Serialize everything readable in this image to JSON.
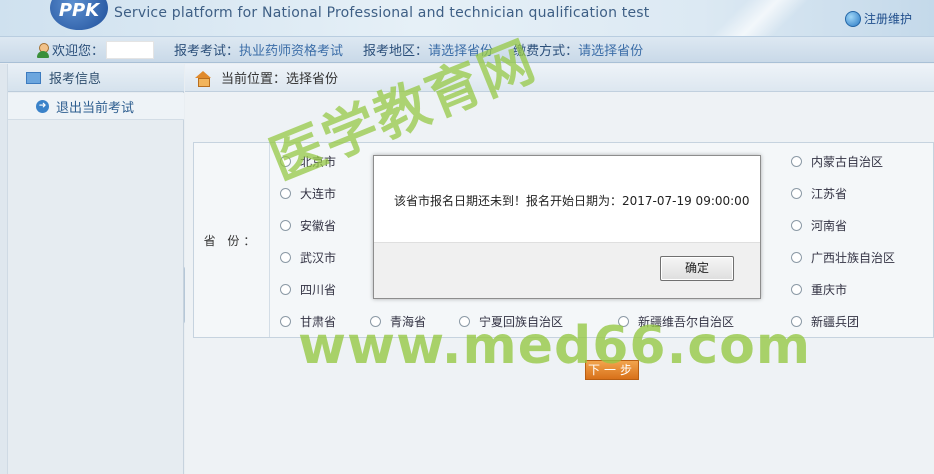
{
  "header": {
    "logo_text": "PPK",
    "subtitle": "Service platform for National Professional and technician qualification test",
    "register_link": "注册维护"
  },
  "infobar": {
    "welcome_label": "欢迎您：",
    "exam_label": "报考考试：",
    "exam_value": "执业药师资格考试",
    "region_label": "报考地区：",
    "region_value": "请选择省份",
    "payment_label": "缴费方式：",
    "payment_value": "请选择省份"
  },
  "sidebar": {
    "header": "报考信息",
    "items": [
      {
        "label": "退出当前考试"
      }
    ]
  },
  "main": {
    "breadcrumb": "当前位置：选择省份",
    "province_label": "省 份：",
    "provinces": [
      "北京市",
      "内蒙古自治区",
      "大连市",
      "江苏省",
      "安徽省",
      "河南省",
      "武汉市",
      "广西壮族自治区",
      "四川省",
      "重庆市",
      "甘肃省",
      "青海省",
      "宁夏回族自治区",
      "新疆维吾尔自治区",
      "新疆兵团"
    ],
    "next_button": "下一步"
  },
  "dialog": {
    "message": "该省市报名日期还未到！报名开始日期为：2017-07-19 09:00:00",
    "ok_button": "确定"
  },
  "watermark": {
    "cn": "医学教育网",
    "url": "www.med66.com"
  }
}
